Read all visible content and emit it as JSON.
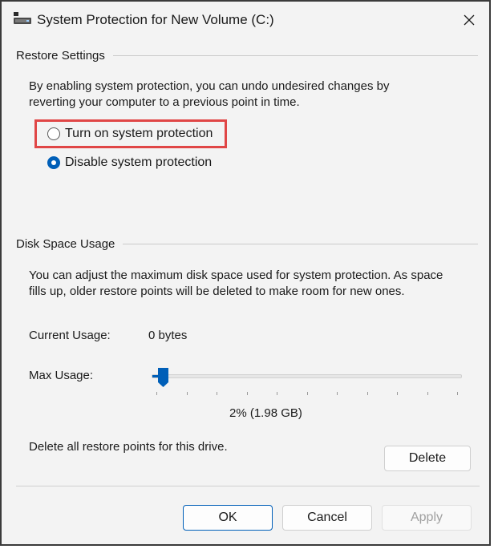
{
  "window": {
    "title": "System Protection for New Volume (C:)"
  },
  "restore_settings": {
    "group_label": "Restore Settings",
    "description_line1": "By enabling system protection, you can undo undesired changes by",
    "description_line2": "reverting your computer to a previous point in time.",
    "options": [
      {
        "label": "Turn on system protection",
        "selected": false
      },
      {
        "label": "Disable system protection",
        "selected": true
      }
    ]
  },
  "disk_space": {
    "group_label": "Disk Space Usage",
    "description_line1": "You can adjust the maximum disk space used for system protection. As space",
    "description_line2": "fills up, older restore points will be deleted to make room for new ones.",
    "current_usage_label": "Current Usage:",
    "current_usage_value": "0 bytes",
    "max_usage_label": "Max Usage:",
    "max_usage_percent": 2,
    "max_usage_readout": "2% (1.98 GB)",
    "delete_text": "Delete all restore points for this drive.",
    "delete_button": "Delete"
  },
  "footer": {
    "ok": "OK",
    "cancel": "Cancel",
    "apply": "Apply"
  },
  "colors": {
    "accent": "#005fb8",
    "highlight": "#e04646"
  }
}
